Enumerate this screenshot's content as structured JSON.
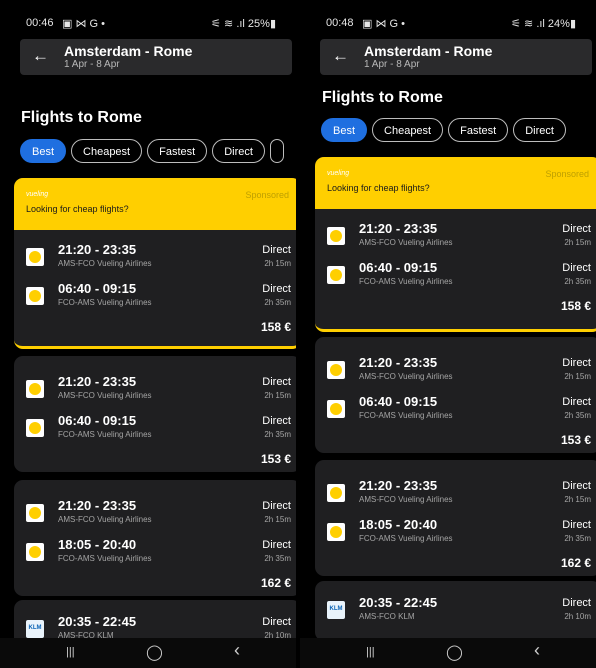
{
  "screens": [
    {
      "status": {
        "time": "00:46",
        "icons_left": "▣ ⋈ G •",
        "icons_right": "⚟ ≋ .ıl 25%▮"
      },
      "header": {
        "back_icon": "arrow-left",
        "title": "Amsterdam - Rome",
        "dates": "1 Apr - 8 Apr"
      },
      "heading": "Flights to Rome",
      "filters": [
        "Best",
        "Cheapest",
        "Fastest",
        "Direct",
        ""
      ],
      "sponsored": {
        "brand": "vueling",
        "label": "Sponsored",
        "text": "Looking for cheap flights?"
      },
      "cards": [
        {
          "price": "158 €",
          "legs": [
            {
              "times": "21:20 - 23:35",
              "route": "AMS-FCO  Vueling Airlines",
              "stops": "Direct",
              "duration": "2h 15m",
              "logo": "vueling"
            },
            {
              "times": "06:40 - 09:15",
              "route": "FCO-AMS  Vueling Airlines",
              "stops": "Direct",
              "duration": "2h 35m",
              "logo": "vueling"
            }
          ]
        },
        {
          "price": "153 €",
          "legs": [
            {
              "times": "21:20 - 23:35",
              "route": "AMS-FCO  Vueling Airlines",
              "stops": "Direct",
              "duration": "2h 15m",
              "logo": "vueling"
            },
            {
              "times": "06:40 - 09:15",
              "route": "FCO-AMS  Vueling Airlines",
              "stops": "Direct",
              "duration": "2h 35m",
              "logo": "vueling"
            }
          ]
        },
        {
          "price": "162 €",
          "legs": [
            {
              "times": "21:20 - 23:35",
              "route": "AMS-FCO  Vueling Airlines",
              "stops": "Direct",
              "duration": "2h 15m",
              "logo": "vueling"
            },
            {
              "times": "18:05 - 20:40",
              "route": "FCO-AMS  Vueling Airlines",
              "stops": "Direct",
              "duration": "2h 35m",
              "logo": "vueling"
            }
          ]
        },
        {
          "price": "",
          "legs": [
            {
              "times": "20:35 - 22:45",
              "route": "AMS-FCO  KLM",
              "stops": "Direct",
              "duration": "2h 10m",
              "logo": "klm"
            }
          ]
        }
      ],
      "navbar": {
        "recent": "|||",
        "home": "◯",
        "back": "‹"
      }
    },
    {
      "status": {
        "time": "00:48",
        "icons_left": "▣ ⋈ G •",
        "icons_right": "⚟ ≋ .ıl 24%▮"
      },
      "header": {
        "back_icon": "arrow-left",
        "title": "Amsterdam - Rome",
        "dates": "1 Apr - 8 Apr"
      },
      "heading": "Flights to Rome",
      "filters": [
        "Best",
        "Cheapest",
        "Fastest",
        "Direct"
      ],
      "sponsored": {
        "brand": "vueling",
        "label": "Sponsored",
        "text": "Looking for cheap flights?"
      },
      "cards": [
        {
          "price": "158 €",
          "legs": [
            {
              "times": "21:20 - 23:35",
              "route": "AMS-FCO  Vueling Airlines",
              "stops": "Direct",
              "duration": "2h 15m",
              "logo": "vueling"
            },
            {
              "times": "06:40 - 09:15",
              "route": "FCO-AMS  Vueling Airlines",
              "stops": "Direct",
              "duration": "2h 35m",
              "logo": "vueling"
            }
          ]
        },
        {
          "price": "153 €",
          "legs": [
            {
              "times": "21:20 - 23:35",
              "route": "AMS-FCO  Vueling Airlines",
              "stops": "Direct",
              "duration": "2h 15m",
              "logo": "vueling"
            },
            {
              "times": "06:40 - 09:15",
              "route": "FCO-AMS  Vueling Airlines",
              "stops": "Direct",
              "duration": "2h 35m",
              "logo": "vueling"
            }
          ]
        },
        {
          "price": "162 €",
          "legs": [
            {
              "times": "21:20 - 23:35",
              "route": "AMS-FCO  Vueling Airlines",
              "stops": "Direct",
              "duration": "2h 15m",
              "logo": "vueling"
            },
            {
              "times": "18:05 - 20:40",
              "route": "FCO-AMS  Vueling Airlines",
              "stops": "Direct",
              "duration": "2h 35m",
              "logo": "vueling"
            }
          ]
        },
        {
          "price": "",
          "legs": [
            {
              "times": "20:35 - 22:45",
              "route": "AMS-FCO  KLM",
              "stops": "Direct",
              "duration": "2h 10m",
              "logo": "klm"
            }
          ]
        }
      ],
      "navbar": {
        "recent": "|||",
        "home": "◯",
        "back": "‹"
      }
    }
  ]
}
